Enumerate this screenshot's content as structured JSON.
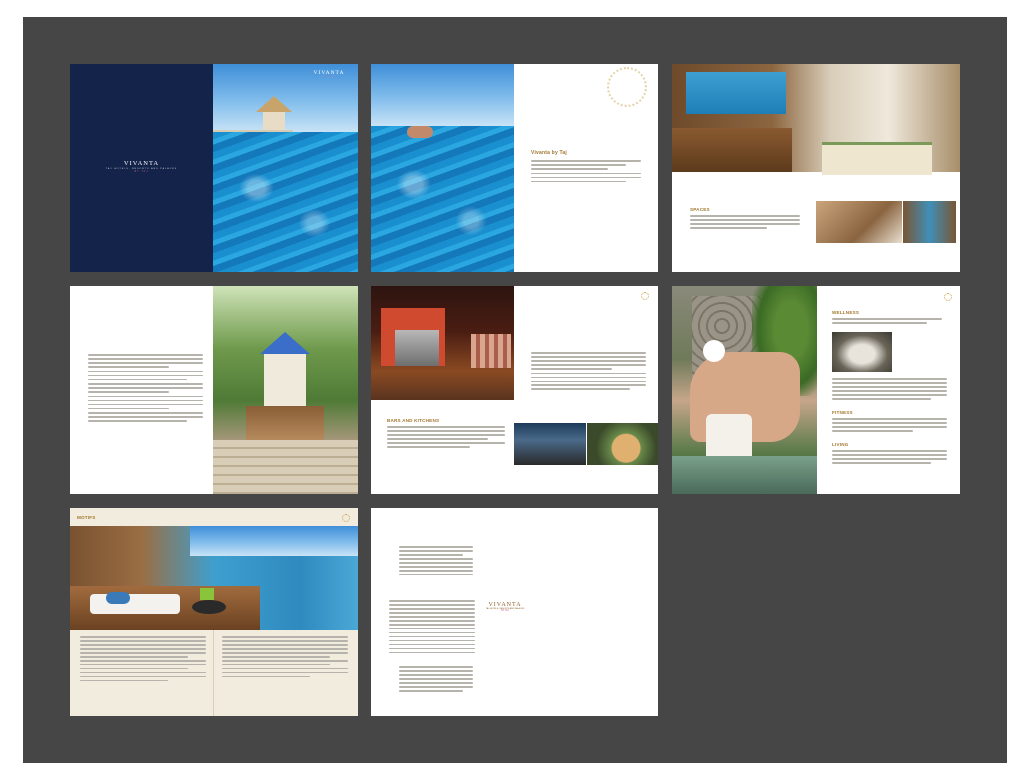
{
  "brand": {
    "name": "VIVANTA",
    "tagline": "TAJ HOTELS, RESORTS AND PALACES",
    "sub": "BY TAJ"
  },
  "pages": {
    "cover": {
      "label": "cover-spread"
    },
    "intro": {
      "title": "Vivanta by Taj"
    },
    "spaces": {
      "heading": "SPACES"
    },
    "dining": {
      "heading": "BARS AND KITCHENS"
    },
    "wellness": {
      "sections": [
        "WELLNESS",
        "FITNESS",
        "LIVING"
      ]
    },
    "motifs": {
      "heading": "MOTIFS"
    }
  },
  "icons": {
    "sun": "sun-motif-icon",
    "face": "face-blur"
  }
}
